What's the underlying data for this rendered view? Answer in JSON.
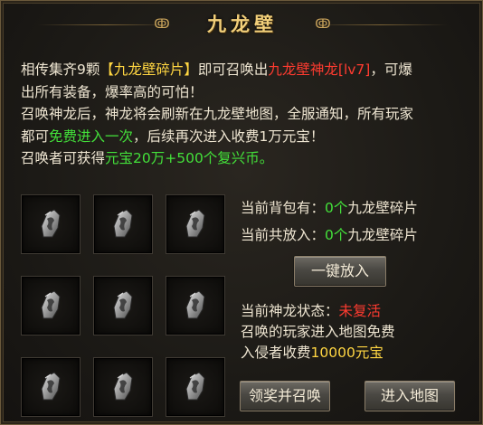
{
  "window": {
    "title": "九龙壁"
  },
  "description": {
    "line1_prefix": "相传集齐9颗",
    "line1_item": "【九龙壁碎片】",
    "line1_mid": "即可召唤出",
    "line1_boss": "九龙壁神龙[lv7]",
    "line1_suffix": "，可爆",
    "line2": "出所有装备，爆率高的可怕！",
    "line3": "召唤神龙后，神龙将会刷新在九龙壁地图，全服通知，所有玩家",
    "line4_prefix": "都可",
    "line4_free": "免费进入一次",
    "line4_suffix": "，后续再次进入收费1万元宝！",
    "line5_prefix": "召唤者可获得",
    "line5_reward": "元宝20万+500个复兴币。"
  },
  "stats": {
    "bag_label": "当前背包有：",
    "bag_count": "0个",
    "bag_item": "九龙壁碎片",
    "placed_label": "当前共放入：",
    "placed_count": "0个",
    "placed_item": "九龙壁碎片"
  },
  "buttons": {
    "place_all": "一键放入",
    "claim_summon": "领奖并召唤",
    "enter_map": "进入地图"
  },
  "dragon_status": {
    "label": "当前神龙状态：",
    "value": "未复活",
    "line2": "召唤的玩家进入地图免费",
    "line3_prefix": "入侵者收费",
    "line3_fee": "10000元宝"
  },
  "fragment_slots": [
    {
      "icon": "dragon-fragment-icon"
    },
    {
      "icon": "dragon-fragment-icon"
    },
    {
      "icon": "dragon-fragment-icon"
    },
    {
      "icon": "dragon-fragment-icon"
    },
    {
      "icon": "dragon-fragment-icon"
    },
    {
      "icon": "dragon-fragment-icon"
    },
    {
      "icon": "dragon-fragment-icon"
    },
    {
      "icon": "dragon-fragment-icon"
    },
    {
      "icon": "dragon-fragment-icon"
    }
  ],
  "colors": {
    "title": "#f2cf7a",
    "highlight_yellow": "#ffd642",
    "highlight_red": "#ff3b30",
    "highlight_green": "#43e03a",
    "text": "#efe6d2"
  }
}
